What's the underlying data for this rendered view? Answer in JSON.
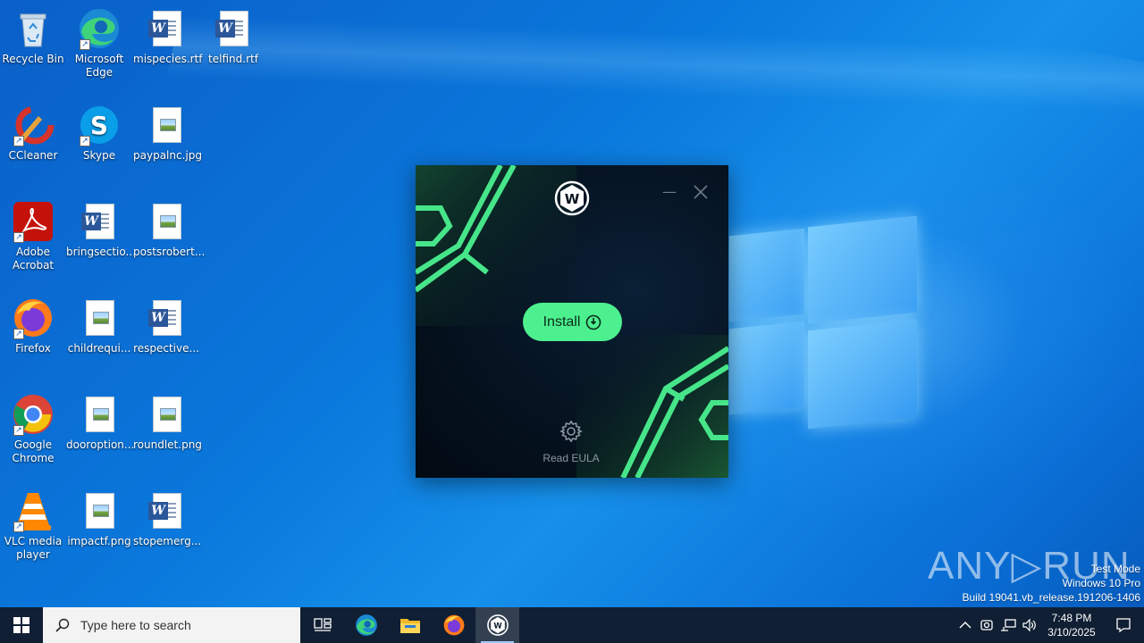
{
  "desktop": {
    "icons": [
      {
        "label": "Recycle Bin",
        "icon": "recycle-bin-icon"
      },
      {
        "label": "Microsoft Edge",
        "icon": "edge-icon"
      },
      {
        "label": "mispecies.rtf",
        "icon": "word-document-icon"
      },
      {
        "label": "telfind.rtf",
        "icon": "word-document-icon"
      },
      {
        "label": "CCleaner",
        "icon": "ccleaner-icon"
      },
      {
        "label": "Skype",
        "icon": "skype-icon"
      },
      {
        "label": "paypalnc.jpg",
        "icon": "image-file-icon"
      },
      {
        "label": "Adobe Acrobat",
        "icon": "acrobat-icon"
      },
      {
        "label": "bringsectio...",
        "icon": "word-document-icon"
      },
      {
        "label": "postsrobert...",
        "icon": "image-file-icon"
      },
      {
        "label": "Firefox",
        "icon": "firefox-icon"
      },
      {
        "label": "childrequi...",
        "icon": "image-file-icon"
      },
      {
        "label": "respective...",
        "icon": "word-document-icon"
      },
      {
        "label": "Google Chrome",
        "icon": "chrome-icon"
      },
      {
        "label": "dooroption...",
        "icon": "image-file-icon"
      },
      {
        "label": "roundlet.png",
        "icon": "image-file-icon"
      },
      {
        "label": "VLC media player",
        "icon": "vlc-icon"
      },
      {
        "label": "impactf.png",
        "icon": "image-file-icon"
      },
      {
        "label": "stopemerg...",
        "icon": "word-document-icon"
      }
    ]
  },
  "installer": {
    "logo_icon": "windscribe-logo-icon",
    "install_label": "Install",
    "install_icon": "power-icon",
    "eula_label": "Read EULA",
    "eula_icon": "gear-icon",
    "accent": "#4df08f"
  },
  "watermark": {
    "brand": "ANY▷RUN",
    "line1": "Test Mode",
    "line2": "Windows 10 Pro",
    "line3": "Build 19041.vb_release.191206-1406"
  },
  "taskbar": {
    "search_placeholder": "Type here to search",
    "pinned": [
      "task-view-icon",
      "edge-icon",
      "file-explorer-icon",
      "firefox-icon",
      "windscribe-icon"
    ],
    "time": "7:48 PM",
    "date": "3/10/2025"
  }
}
